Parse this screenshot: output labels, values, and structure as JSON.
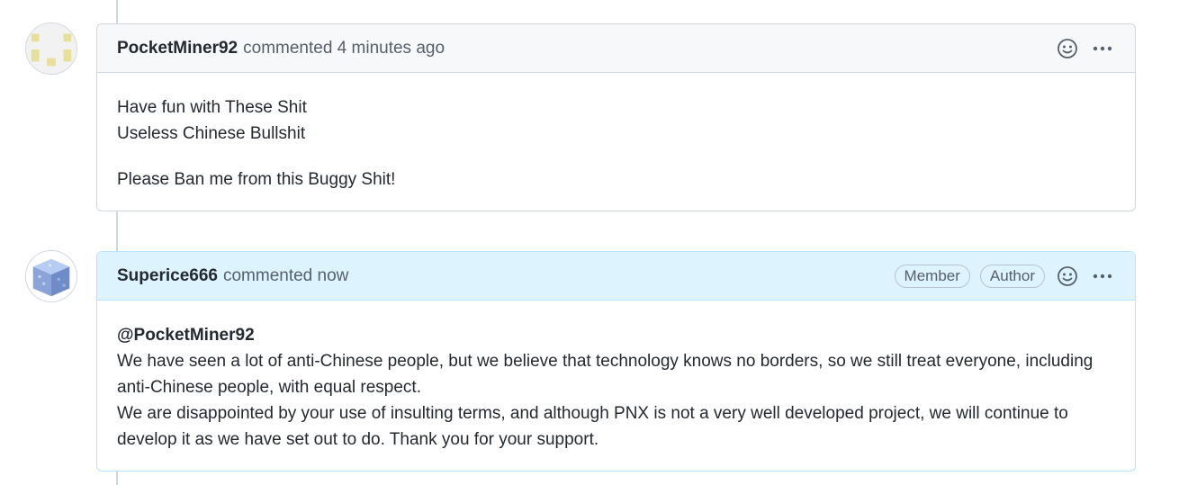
{
  "comments": [
    {
      "author": "PocketMiner92",
      "meta": "commented 4 minutes ago",
      "body_lines": [
        "Have fun with These Shit",
        "Useless Chinese Bullshit"
      ],
      "body_para2": "Please Ban me from this Buggy Shit!"
    },
    {
      "author": "Superice666",
      "meta": "commented now",
      "badges": [
        "Member",
        "Author"
      ],
      "mention": "@PocketMiner92",
      "body_line1": "We have seen a lot of anti-Chinese people, but we believe that technology knows no borders, so we still treat everyone, including",
      "body_line2": "anti-Chinese people, with equal respect.",
      "body_line3": "We are disappointed by your use of insulting terms, and although PNX is not a very well developed project, we will continue to",
      "body_line4": "develop it as we have set out to do. Thank you for your support."
    }
  ],
  "icons": {
    "reaction": "smiley-icon",
    "menu": "kebab-horizontal-icon"
  },
  "colors": {
    "accent_header": "#ddf4ff",
    "accent_border": "#b6e3ff",
    "header_bg": "#f6f8fa"
  }
}
